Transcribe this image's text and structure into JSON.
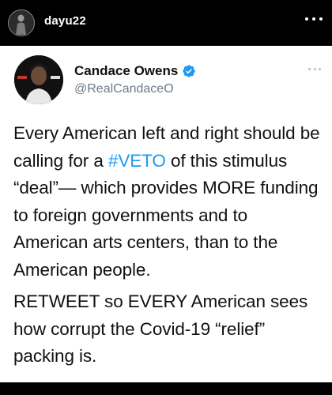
{
  "post": {
    "username": "dayu22",
    "more_icon": "more-horizontal-icon"
  },
  "tweet": {
    "display_name": "Candace Owens",
    "handle": "@RealCandaceO",
    "verified_icon": "verified-badge-icon",
    "verified_color": "#1d9bf0",
    "paragraph1_before": "Every American left and right should be calling for a ",
    "hashtag": "#VETO",
    "paragraph1_after": " of this stimulus “deal”— which provides MORE funding to foreign governments and to American arts centers, than to the American people.",
    "paragraph2": "RETWEET so EVERY American sees how corrupt the Covid-19 “relief” packing is.",
    "link_color": "#1d9bf0"
  }
}
